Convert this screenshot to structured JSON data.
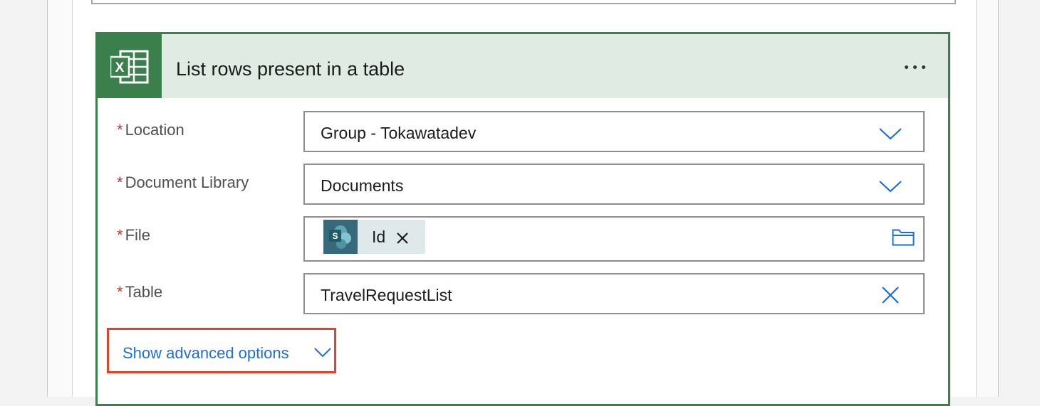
{
  "card": {
    "title": "List rows present in a table",
    "icon": "excel-icon",
    "accent_color": "#3a7f4c",
    "header_bg": "#e0ebe4"
  },
  "fields": {
    "location": {
      "label": "Location",
      "value": "Group - Tokawatadev",
      "required": "*"
    },
    "library": {
      "label": "Document Library",
      "value": "Documents",
      "required": "*"
    },
    "file": {
      "label": "File",
      "token": "Id",
      "token_icon": "sharepoint-icon",
      "required": "*"
    },
    "table": {
      "label": "Table",
      "value": "TravelRequestList",
      "required": "*"
    }
  },
  "advanced": {
    "label": "Show advanced options",
    "highlight_color": "#e0442b"
  },
  "colors": {
    "link": "#1f6ed4",
    "required": "#c0392b"
  }
}
